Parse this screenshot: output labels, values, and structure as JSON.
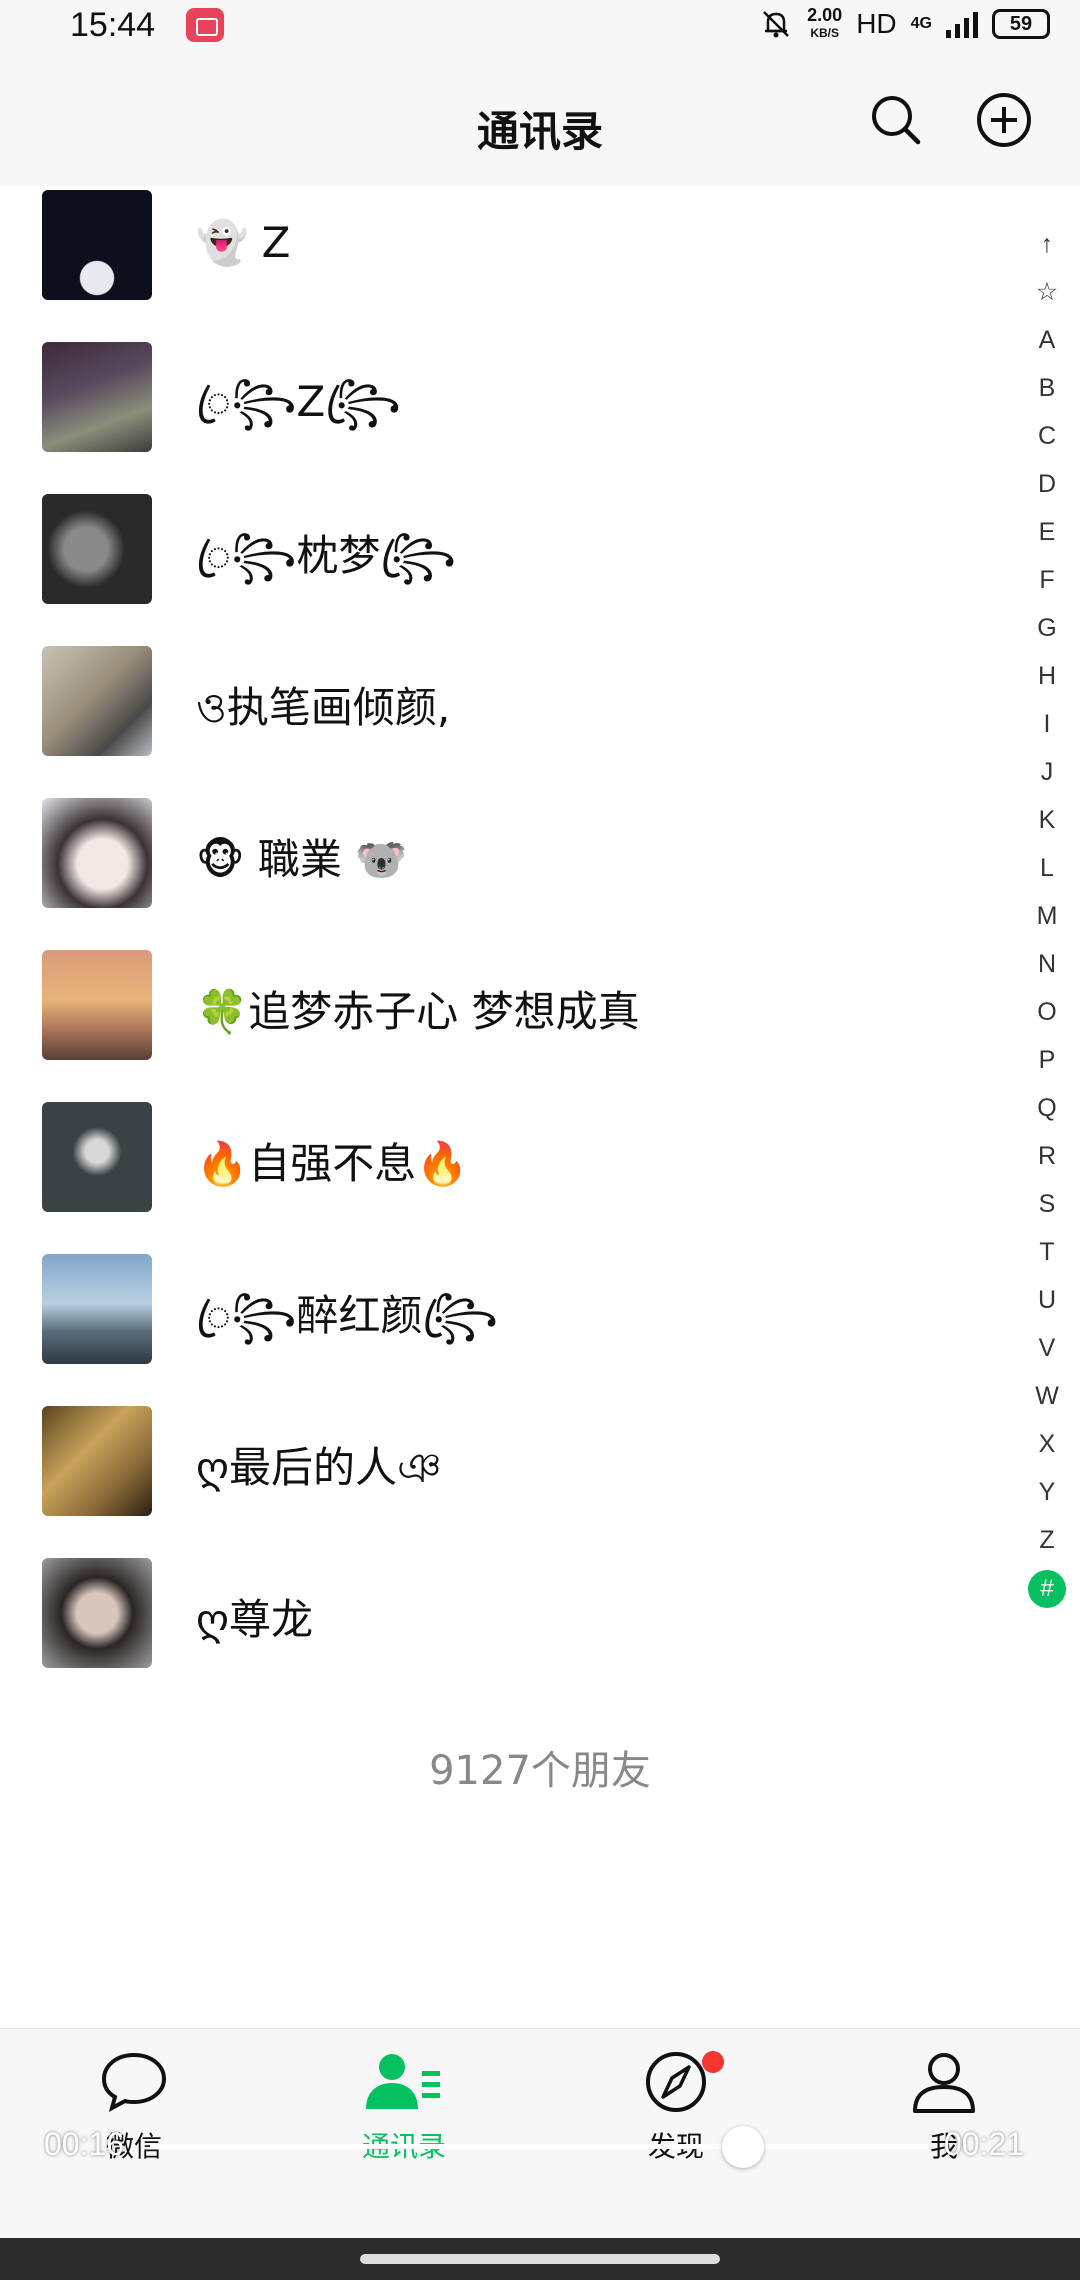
{
  "status_bar": {
    "time": "15:44",
    "network_speed_value": "2.00",
    "network_speed_unit": "KB/S",
    "hd_label": "HD",
    "network_type": "4G",
    "battery": "59"
  },
  "header": {
    "title": "通讯录"
  },
  "contacts": [
    {
      "name": "👻 Z"
    },
    {
      "name": "ꦿ꧂Z꧂ꦿ"
    },
    {
      "name": "ꦿ꧂枕梦꧂ꦿ"
    },
    {
      "name": "ও执笔画倾颜,"
    },
    {
      "name": "🐵 職業 🐨"
    },
    {
      "name": "🍀追梦赤子心  梦想成真"
    },
    {
      "name": "🔥自强不息🔥"
    },
    {
      "name": "ꦿ꧂醉红颜꧂ꦿ"
    },
    {
      "name": "ღ最后的人ঞ"
    },
    {
      "name": "ღ尊龙"
    }
  ],
  "index_letters": [
    "↑",
    "☆",
    "A",
    "B",
    "C",
    "D",
    "E",
    "F",
    "G",
    "H",
    "I",
    "J",
    "K",
    "L",
    "M",
    "N",
    "O",
    "P",
    "Q",
    "R",
    "S",
    "T",
    "U",
    "V",
    "W",
    "X",
    "Y",
    "Z"
  ],
  "index_active": "#",
  "friend_count": "9127个朋友",
  "tabs": [
    {
      "label": "微信",
      "icon": "chat-bubble-icon"
    },
    {
      "label": "通讯录",
      "icon": "contacts-icon",
      "active": true
    },
    {
      "label": "发现",
      "icon": "compass-icon",
      "badge": true
    },
    {
      "label": "我",
      "icon": "person-icon"
    }
  ],
  "video": {
    "elapsed": "00:16",
    "duration": "00:21",
    "progress": 0.76
  },
  "colors": {
    "accent": "#07c160",
    "badge": "#f43530"
  }
}
